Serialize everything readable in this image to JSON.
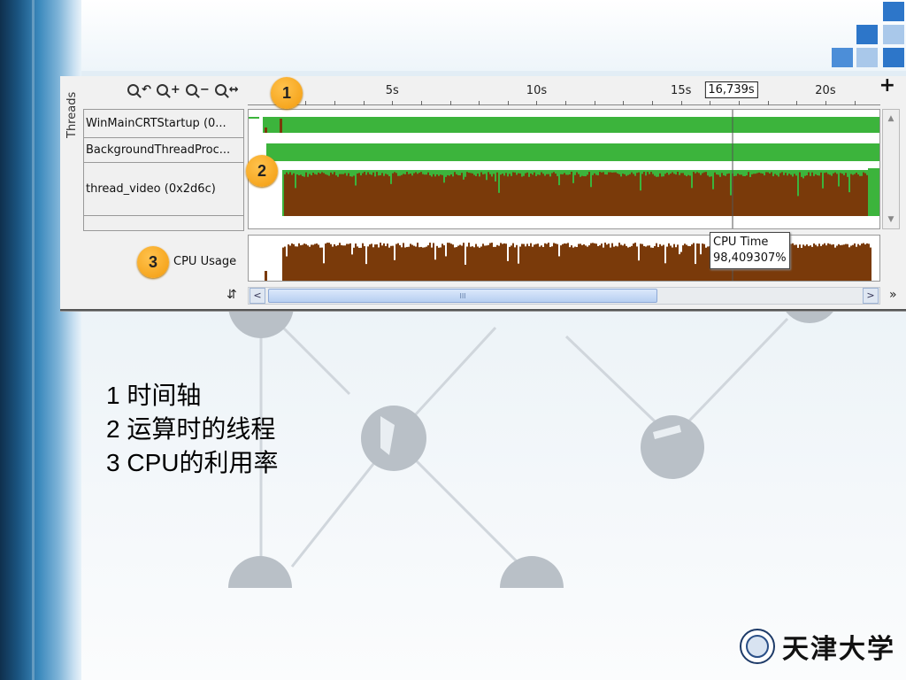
{
  "toolbar": {
    "zoom_out": "−",
    "zoom_in": "+",
    "zoom_fit": "↔",
    "zoom_undo": "↶",
    "add": "+"
  },
  "ruler": {
    "ticks": [
      {
        "label": "5s",
        "t": 5
      },
      {
        "label": "10s",
        "t": 10
      },
      {
        "label": "15s",
        "t": 15
      },
      {
        "label": "20s",
        "t": 20
      }
    ],
    "cursor_label": "16,739s",
    "cursor_t": 16.739,
    "start_t": 0,
    "end_t": 21.9
  },
  "threads_title": "Threads",
  "threads": [
    {
      "label": "WinMainCRTStartup (0..."
    },
    {
      "label": "BackgroundThreadProc..."
    },
    {
      "label": "thread_video (0x2d6c)"
    }
  ],
  "cpu": {
    "label": "CPU Usage",
    "tooltip_title": "CPU Time",
    "tooltip_value": "98,409307%"
  },
  "badges": [
    "1",
    "2",
    "3"
  ],
  "scroll": {
    "swap": "⇵",
    "left": "<",
    "right": ">",
    "grip": "III",
    "more": "»"
  },
  "captions": [
    "1 时间轴",
    "2 运算时的线程",
    "3 CPU的利用率"
  ],
  "logo": {
    "text": "天津大学"
  },
  "colors": {
    "running": "#3cb43c",
    "busy": "#7a3a0a",
    "badge": "#f5a623"
  }
}
